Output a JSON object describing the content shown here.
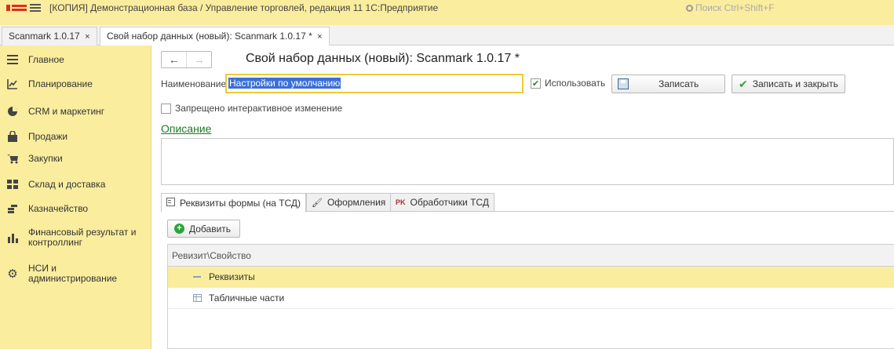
{
  "app": {
    "title": "[КОПИЯ] Демонстрационная база / Управление торговлей, редакция 11 1С:Предприятие",
    "search_placeholder": "Поиск Ctrl+Shift+F"
  },
  "open_tabs": [
    {
      "label": "Scanmark 1.0.17",
      "close": "×"
    },
    {
      "label": "Свой набор данных (новый): Scanmark 1.0.17 *",
      "close": "×"
    }
  ],
  "sidebar": {
    "items": [
      {
        "label": "Главное",
        "icon": "menu-lines-icon"
      },
      {
        "label": "Планирование",
        "icon": "planning-chart-icon"
      },
      {
        "label": "CRM и маркетинг",
        "icon": "crm-pie-icon"
      },
      {
        "label": "Продажи",
        "icon": "bag-icon"
      },
      {
        "label": "Закупки",
        "icon": "cart-icon"
      },
      {
        "label": "Склад и доставка",
        "icon": "warehouse-grid-icon"
      },
      {
        "label": "Казначейство",
        "icon": "coins-icon"
      },
      {
        "label": "Финансовый результат и контроллинг",
        "icon": "bar-chart-icon"
      },
      {
        "label": "НСИ и администрирование",
        "icon": "gear-icon"
      }
    ]
  },
  "form": {
    "title": "Свой набор данных (новый): Scanmark 1.0.17 *",
    "back": "←",
    "forward": "→",
    "name_label": "Наименование:",
    "name_value": "Настройки по умолчанию",
    "use_label": "Использовать",
    "use_checked": true,
    "save_label": "Записать",
    "save_close_label": "Записать и закрыть",
    "interactive_label": "Запрещено интерактивное изменение",
    "interactive_checked": false,
    "description_link": "Описание"
  },
  "inner_tabs": [
    {
      "label": "Реквизиты формы (на ТСД)",
      "icon": "form-fields-icon",
      "active": true
    },
    {
      "label": "Оформления",
      "icon": "brush-icon",
      "active": false
    },
    {
      "label": "Обработчики ТСД",
      "icon": "module-icon",
      "active": false
    }
  ],
  "add_button": "Добавить",
  "grid": {
    "header": "Ревизит\\Свойство",
    "rows": [
      {
        "label": "Реквизиты",
        "icon": "minus-icon",
        "selected": true
      },
      {
        "label": "Табличные части",
        "icon": "table-icon",
        "selected": false
      }
    ]
  },
  "colors": {
    "panel": "#fbed9e",
    "accent_green": "#1a7a23",
    "selection": "#3b6fd8"
  }
}
